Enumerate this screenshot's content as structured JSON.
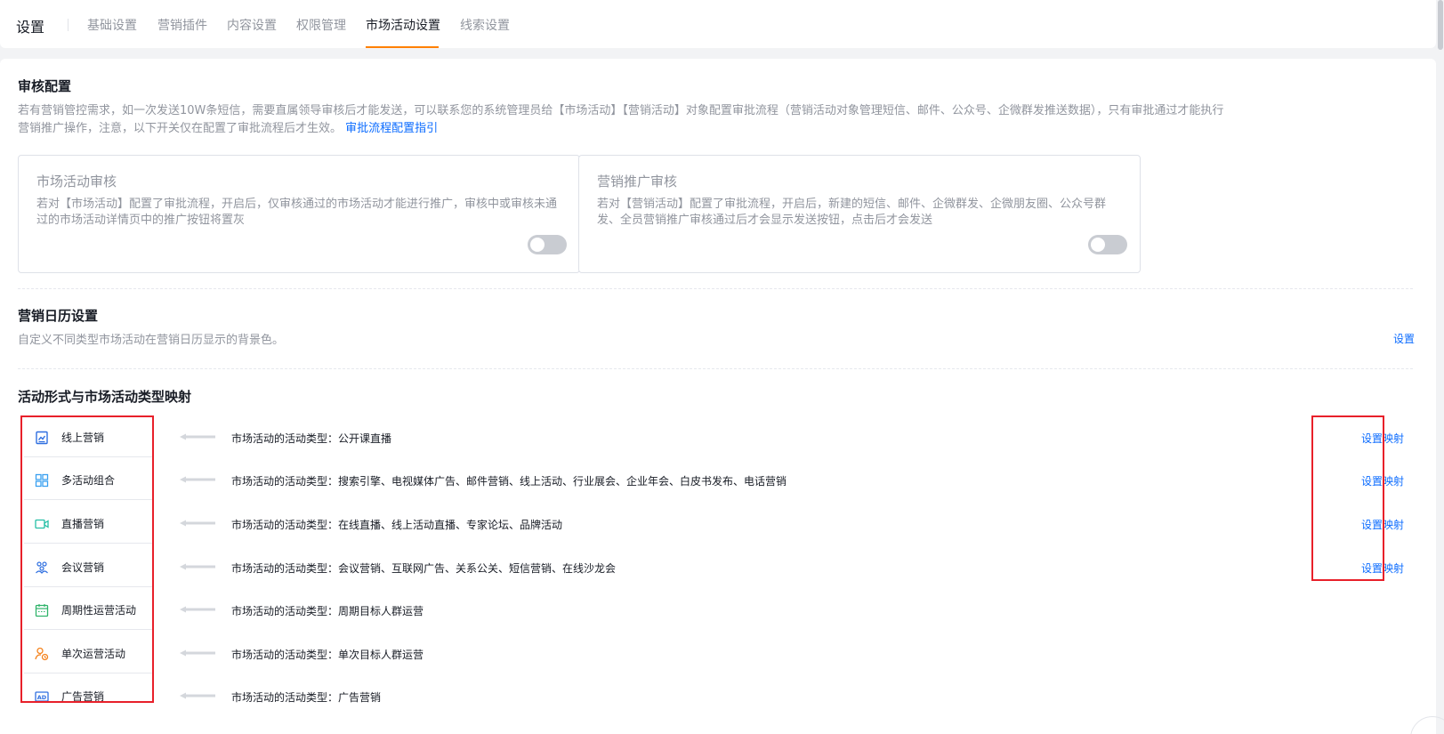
{
  "header": {
    "title": "设置",
    "tabs": [
      {
        "label": "基础设置"
      },
      {
        "label": "营销插件"
      },
      {
        "label": "内容设置"
      },
      {
        "label": "权限管理"
      },
      {
        "label": "市场活动设置"
      },
      {
        "label": "线索设置"
      }
    ],
    "active_tab": "市场活动设置"
  },
  "approval": {
    "title": "审核配置",
    "desc_part1": "若有营销管控需求，如一次发送10W条短信，需要直属领导审核后才能发送，可以联系您的系统管理员给【市场活动】【营销活动】对象配置审批流程（营销活动对象管理短信、邮件、公众号、企微群发推送数据），只有审批通过才能执行",
    "desc_part2": "营销推广操作，注意，以下开关仅在配置了审批流程后才生效。",
    "guide_link": "审批流程配置指引",
    "cards": [
      {
        "title": "市场活动审核",
        "desc": "若对【市场活动】配置了审批流程，开启后，仅审核通过的市场活动才能进行推广，审核中或审核未通过的市场活动详情页中的推广按钮将置灰",
        "enabled": false
      },
      {
        "title": "营销推广审核",
        "desc": "若对【营销活动】配置了审批流程，开启后，新建的短信、邮件、企微群发、企微朋友圈、公众号群发、全员营销推广审核通过后才会显示发送按钮，点击后才会发送",
        "enabled": false
      }
    ]
  },
  "calendar": {
    "title": "营销日历设置",
    "desc": "自定义不同类型市场活动在营销日历显示的背景色。",
    "set_label": "设置"
  },
  "mapping": {
    "title": "活动形式与市场活动类型映射",
    "prefix": "市场活动的活动类型：",
    "rows": [
      {
        "form": "线上营销",
        "icon": "chart-icon",
        "types": "公开课直播",
        "action": "设置映射"
      },
      {
        "form": "多活动组合",
        "icon": "grid-icon",
        "types": "搜索引擎、电视媒体广告、邮件营销、线上活动、行业展会、企业年会、白皮书发布、电话营销",
        "action": "设置映射"
      },
      {
        "form": "直播营销",
        "icon": "video-icon",
        "types": "在线直播、线上活动直播、专家论坛、品牌活动",
        "action": "设置映射"
      },
      {
        "form": "会议营销",
        "icon": "people-icon",
        "types": "会议营销、互联网广告、关系公关、短信营销、在线沙龙会",
        "action": "设置映射"
      },
      {
        "form": "周期性运营活动",
        "icon": "calendar-icon",
        "types": "周期目标人群运营",
        "action": ""
      },
      {
        "form": "单次运营活动",
        "icon": "user-cycle-icon",
        "types": "单次目标人群运营",
        "action": ""
      },
      {
        "form": "广告营销",
        "icon": "ad-icon",
        "types": "广告营销",
        "action": ""
      }
    ]
  },
  "colors": {
    "accent": "#ff8000",
    "link": "#0c6cff",
    "highlight": "#e8202a"
  }
}
